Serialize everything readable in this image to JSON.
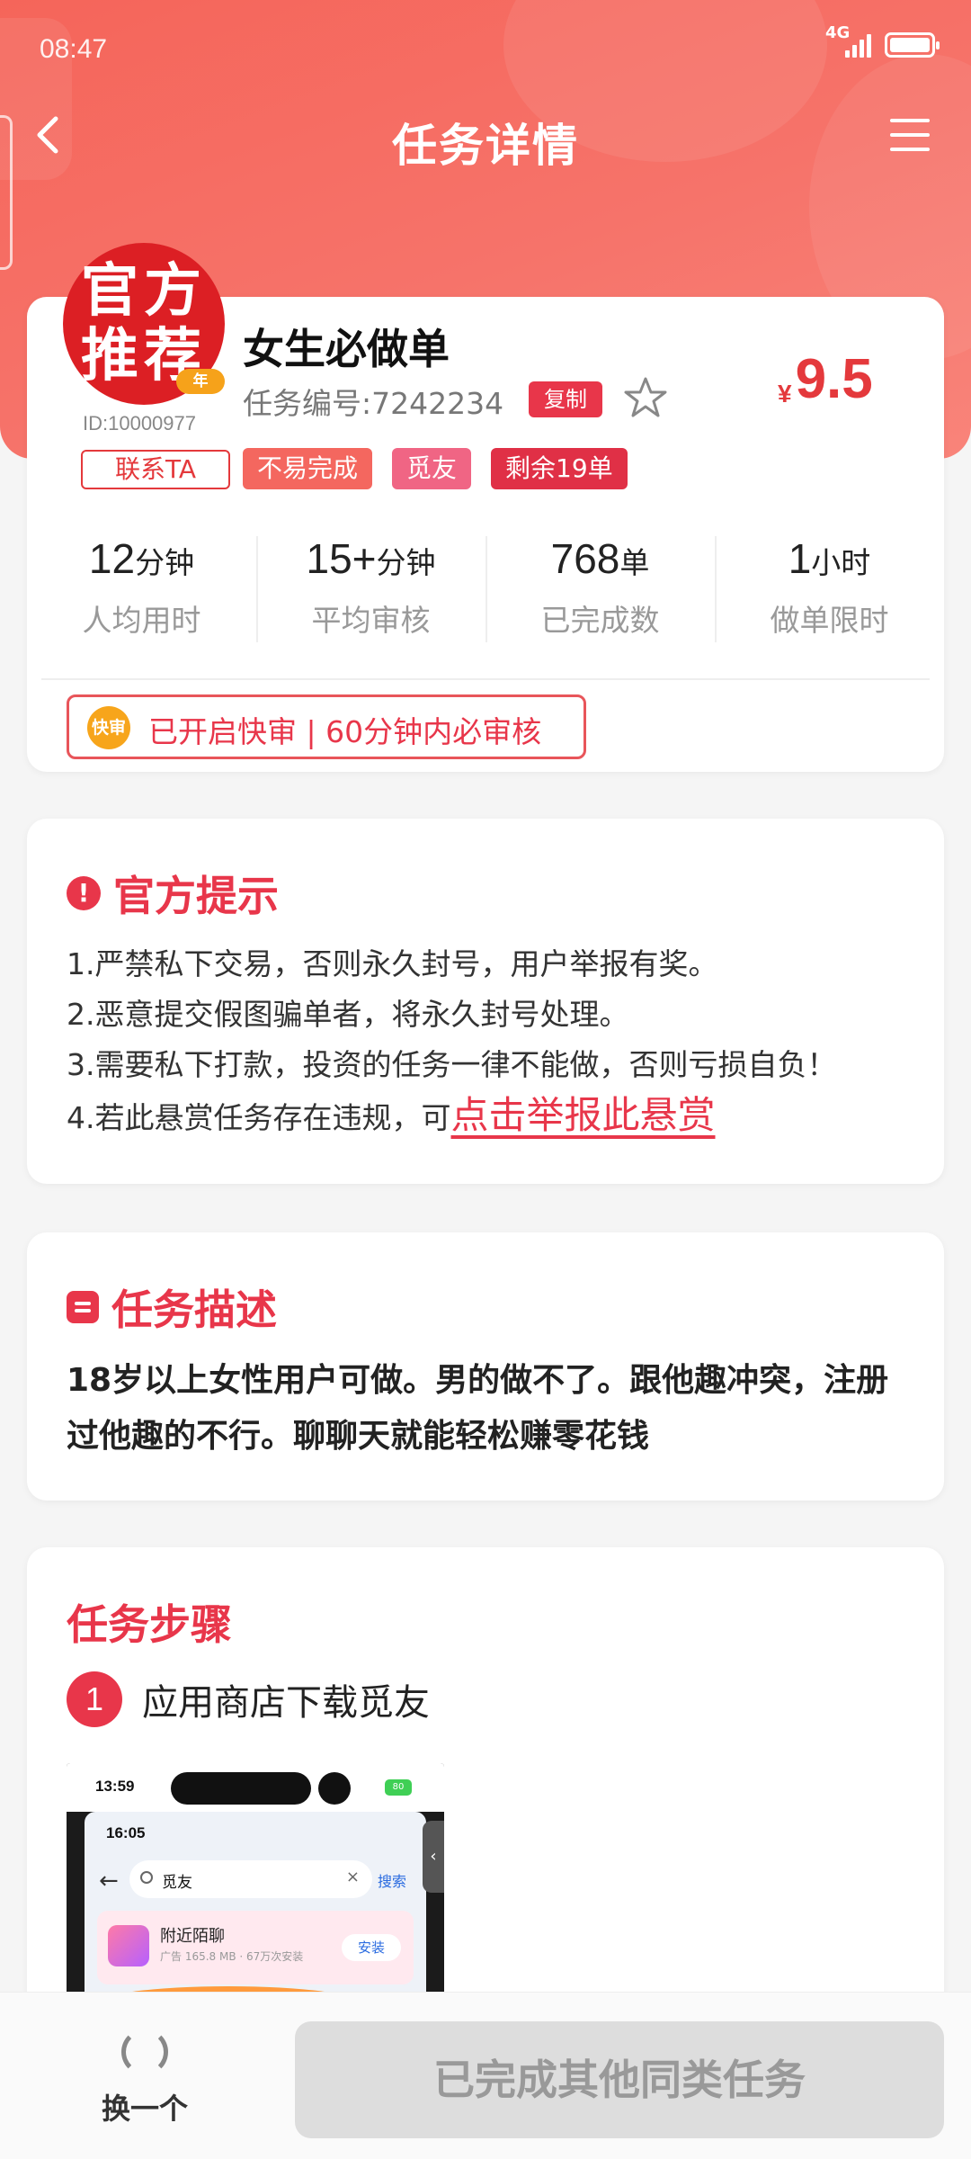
{
  "status_bar": {
    "time": "08:47",
    "network": "4G"
  },
  "nav": {
    "title": "任务详情"
  },
  "task": {
    "badge_line1": "官方",
    "badge_line2": "推荐",
    "badge_sub": "年卡",
    "user_id": "ID:10000977",
    "contact_label": "联系TA",
    "name": "女生必做单",
    "task_no": "任务编号:7242234",
    "copy_label": "复制",
    "currency": "¥",
    "price": "9.5",
    "tags": [
      "不易完成",
      "觅友",
      "剩余19单"
    ],
    "stats": [
      {
        "value": "12",
        "unit": "分钟",
        "label": "人均用时"
      },
      {
        "value": "15+",
        "unit": "分钟",
        "label": "平均审核"
      },
      {
        "value": "768",
        "unit": "单",
        "label": "已完成数"
      },
      {
        "value": "1",
        "unit": "小时",
        "label": "做单限时"
      }
    ],
    "fast_icon_label": "快审",
    "fast_text": "已开启快审 | 60分钟内必审核"
  },
  "tips": {
    "title": "官方提示",
    "lines": [
      "1.严禁私下交易，否则永久封号，用户举报有奖。",
      "2.恶意提交假图骗单者，将永久封号处理。",
      "3.需要私下打款，投资的任务一律不能做，否则亏损自负！"
    ],
    "line4_prefix": "4.若此悬赏任务存在违规，可",
    "report_link": "点击举报此悬赏"
  },
  "description": {
    "title": "任务描述",
    "text": "18岁以上女性用户可做。男的做不了。跟他趣冲突，注册过他趣的不行。聊聊天就能轻松赚零花钱"
  },
  "steps": {
    "title": "任务步骤",
    "items": [
      {
        "num": "1",
        "text": "应用商店下载觅友"
      }
    ],
    "screenshot": {
      "status_time": "13:59",
      "inner_time": "16:05",
      "search_query": "觅友",
      "search_button": "搜索",
      "app_name": "附近陌聊",
      "app_meta": "广告 165.8 MB · 67万次安装",
      "install_label": "安装",
      "battery": "80"
    }
  },
  "bottom": {
    "swap_label": "换一个",
    "done_label": "已完成其他同类任务"
  },
  "colors": {
    "brand_red": "#e8364a",
    "header_gradient": "#f5655a"
  }
}
